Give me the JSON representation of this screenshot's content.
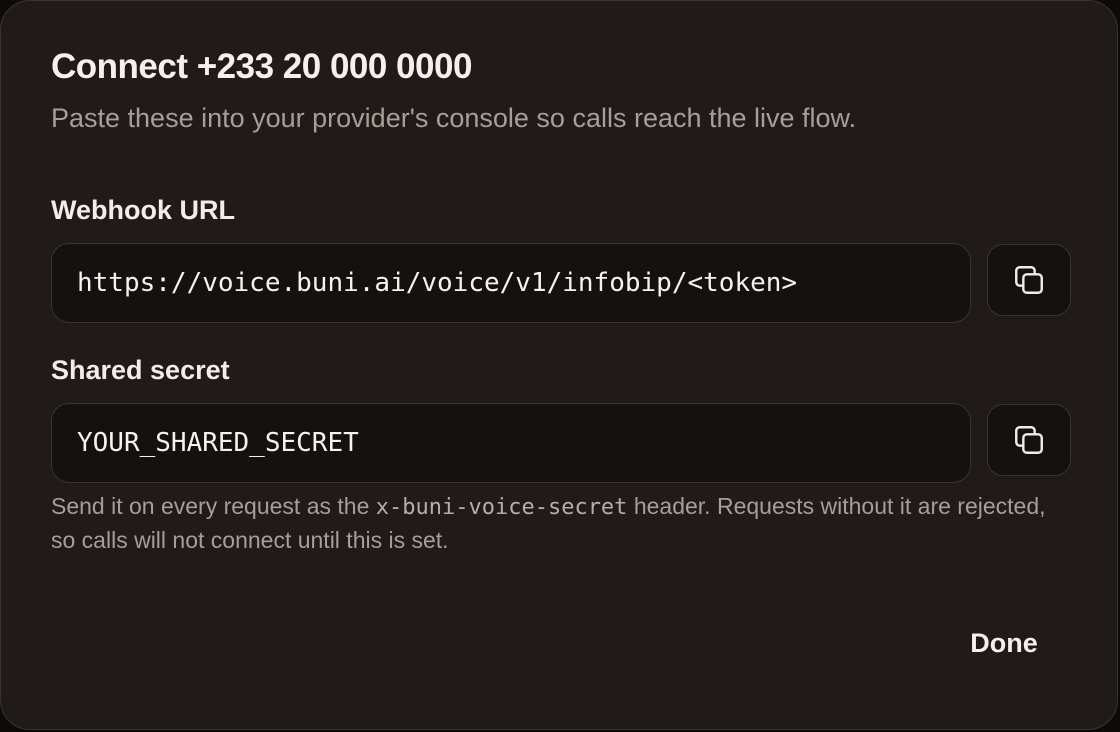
{
  "dialog": {
    "title": "Connect +233 20 000 0000",
    "subtitle": "Paste these into your provider's console so calls reach the live flow."
  },
  "webhook": {
    "label": "Webhook URL",
    "value": "https://voice.buni.ai/voice/v1/infobip/<token>",
    "copy_icon": "copy-icon"
  },
  "secret": {
    "label": "Shared secret",
    "value": "YOUR_SHARED_SECRET",
    "copy_icon": "copy-icon"
  },
  "help": {
    "prefix": "Send it on every request as the ",
    "header_name": "x-buni-voice-secret",
    "suffix": " header. Requests without it are rejected, so calls will not connect until this is set."
  },
  "footer": {
    "done_label": "Done"
  },
  "colors": {
    "dialog_bg": "#201b19",
    "field_bg": "#151110",
    "border": "#3a3431",
    "text": "#f2ecea",
    "muted_text": "#a79d99"
  }
}
